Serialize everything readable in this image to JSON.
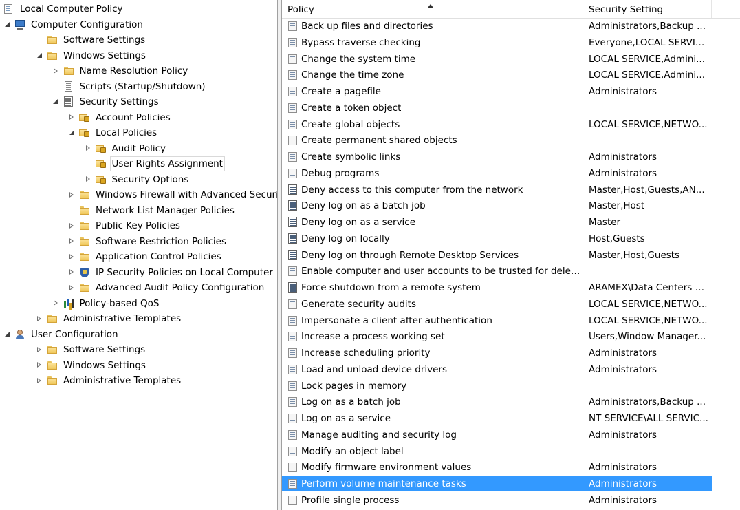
{
  "tree": [
    {
      "label": "Local Computer Policy",
      "icon": "policy-icon",
      "expander": "none"
    },
    {
      "label": "Computer Configuration",
      "icon": "computer-icon",
      "expander": "expanded"
    },
    {
      "label": "Software Settings",
      "icon": "folder-icon",
      "expander": "none"
    },
    {
      "label": "Windows Settings",
      "icon": "folder-icon",
      "expander": "expanded"
    },
    {
      "label": "Name Resolution Policy",
      "icon": "folder-icon",
      "expander": "collapsed"
    },
    {
      "label": "Scripts (Startup/Shutdown)",
      "icon": "script-icon",
      "expander": "none"
    },
    {
      "label": "Security Settings",
      "icon": "security-settings-icon",
      "expander": "expanded"
    },
    {
      "label": "Account Policies",
      "icon": "lock-folder-icon",
      "expander": "collapsed"
    },
    {
      "label": "Local Policies",
      "icon": "lock-folder-icon",
      "expander": "expanded"
    },
    {
      "label": "Audit Policy",
      "icon": "lock-folder-icon",
      "expander": "collapsed"
    },
    {
      "label": "User Rights Assignment",
      "icon": "lock-folder-icon",
      "expander": "none",
      "selected": true
    },
    {
      "label": "Security Options",
      "icon": "lock-folder-icon",
      "expander": "collapsed"
    },
    {
      "label": "Windows Firewall with Advanced Security",
      "icon": "folder-icon",
      "expander": "collapsed"
    },
    {
      "label": "Network List Manager Policies",
      "icon": "folder-icon",
      "expander": "none"
    },
    {
      "label": "Public Key Policies",
      "icon": "folder-icon",
      "expander": "collapsed"
    },
    {
      "label": "Software Restriction Policies",
      "icon": "folder-icon",
      "expander": "collapsed"
    },
    {
      "label": "Application Control Policies",
      "icon": "folder-icon",
      "expander": "collapsed"
    },
    {
      "label": "IP Security Policies on Local Computer",
      "icon": "shield-icon",
      "expander": "collapsed"
    },
    {
      "label": "Advanced Audit Policy Configuration",
      "icon": "folder-icon",
      "expander": "collapsed"
    },
    {
      "label": "Policy-based QoS",
      "icon": "chart-icon",
      "expander": "collapsed"
    },
    {
      "label": "Administrative Templates",
      "icon": "folder-icon",
      "expander": "collapsed"
    },
    {
      "label": "User Configuration",
      "icon": "user-icon",
      "expander": "expanded"
    },
    {
      "label": "Software Settings",
      "icon": "folder-icon",
      "expander": "collapsed"
    },
    {
      "label": "Windows Settings",
      "icon": "folder-icon",
      "expander": "collapsed"
    },
    {
      "label": "Administrative Templates",
      "icon": "folder-icon",
      "expander": "collapsed"
    }
  ],
  "list": {
    "columns": {
      "policy": "Policy",
      "setting": "Security Setting"
    },
    "rows": [
      {
        "policy": "Back up files and directories",
        "setting": "Administrators,Backup ...",
        "icon": "user-right-icon"
      },
      {
        "policy": "Bypass traverse checking",
        "setting": "Everyone,LOCAL SERVIC...",
        "icon": "user-right-icon"
      },
      {
        "policy": "Change the system time",
        "setting": "LOCAL SERVICE,Admini...",
        "icon": "user-right-icon"
      },
      {
        "policy": "Change the time zone",
        "setting": "LOCAL SERVICE,Admini...",
        "icon": "user-right-icon"
      },
      {
        "policy": "Create a pagefile",
        "setting": "Administrators",
        "icon": "user-right-icon"
      },
      {
        "policy": "Create a token object",
        "setting": "",
        "icon": "user-right-icon"
      },
      {
        "policy": "Create global objects",
        "setting": "LOCAL SERVICE,NETWO...",
        "icon": "user-right-icon"
      },
      {
        "policy": "Create permanent shared objects",
        "setting": "",
        "icon": "user-right-icon"
      },
      {
        "policy": "Create symbolic links",
        "setting": "Administrators",
        "icon": "user-right-icon"
      },
      {
        "policy": "Debug programs",
        "setting": "Administrators",
        "icon": "user-right-icon"
      },
      {
        "policy": "Deny access to this computer from the network",
        "setting": "Master,Host,Guests,AN...",
        "icon": "deny-right-icon"
      },
      {
        "policy": "Deny log on as a batch job",
        "setting": "Master,Host",
        "icon": "deny-right-icon"
      },
      {
        "policy": "Deny log on as a service",
        "setting": "Master",
        "icon": "deny-right-icon"
      },
      {
        "policy": "Deny log on locally",
        "setting": "Host,Guests",
        "icon": "deny-right-icon"
      },
      {
        "policy": "Deny log on through Remote Desktop Services",
        "setting": "Master,Host,Guests",
        "icon": "deny-right-icon"
      },
      {
        "policy": "Enable computer and user accounts to be trusted for delega...",
        "setting": "",
        "icon": "user-right-icon"
      },
      {
        "policy": "Force shutdown from a remote system",
        "setting": "ARAMEX\\Data Centers S...",
        "icon": "deny-right-icon"
      },
      {
        "policy": "Generate security audits",
        "setting": "LOCAL SERVICE,NETWO...",
        "icon": "user-right-icon"
      },
      {
        "policy": "Impersonate a client after authentication",
        "setting": "LOCAL SERVICE,NETWO...",
        "icon": "user-right-icon"
      },
      {
        "policy": "Increase a process working set",
        "setting": "Users,Window Manager...",
        "icon": "user-right-icon"
      },
      {
        "policy": "Increase scheduling priority",
        "setting": "Administrators",
        "icon": "user-right-icon"
      },
      {
        "policy": "Load and unload device drivers",
        "setting": "Administrators",
        "icon": "user-right-icon"
      },
      {
        "policy": "Lock pages in memory",
        "setting": "",
        "icon": "user-right-icon"
      },
      {
        "policy": "Log on as a batch job",
        "setting": "Administrators,Backup ...",
        "icon": "user-right-icon"
      },
      {
        "policy": "Log on as a service",
        "setting": "NT SERVICE\\ALL SERVIC...",
        "icon": "user-right-icon"
      },
      {
        "policy": "Manage auditing and security log",
        "setting": "Administrators",
        "icon": "user-right-icon"
      },
      {
        "policy": "Modify an object label",
        "setting": "",
        "icon": "user-right-icon"
      },
      {
        "policy": "Modify firmware environment values",
        "setting": "Administrators",
        "icon": "user-right-icon"
      },
      {
        "policy": "Perform volume maintenance tasks",
        "setting": "Administrators",
        "icon": "user-right-icon",
        "selected": true
      },
      {
        "policy": "Profile single process",
        "setting": "Administrators",
        "icon": "user-right-icon"
      }
    ]
  },
  "colors": {
    "selection": "#3399ff",
    "selection_text": "#ffffff"
  }
}
